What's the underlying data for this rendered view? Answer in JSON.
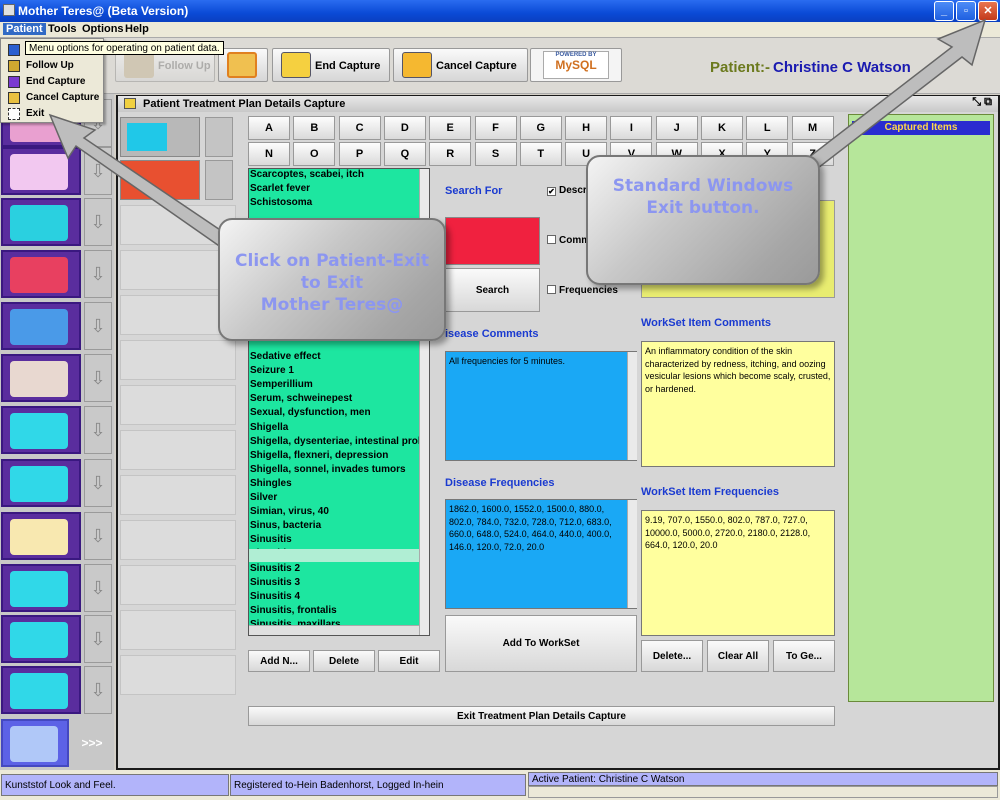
{
  "window": {
    "title": "Mother Teres@ (Beta Version)",
    "btn_minimize": "_",
    "btn_maximize": "▫",
    "btn_close": "✕"
  },
  "menubar": {
    "items": [
      "Patient",
      "Tools",
      "Options",
      "Help"
    ]
  },
  "patient_menu": {
    "tooltip": "Menu options for operating on patient data.",
    "items": [
      "Follow Up",
      "End Capture",
      "Cancel Capture",
      "Exit"
    ]
  },
  "toolbar": {
    "follow_up": "Follow Up",
    "end_capture": "End Capture",
    "cancel_capture": "Cancel Capture",
    "mysql_top": "POWERED BY",
    "mysql_bottom": "MySQL",
    "patient_label": "Patient:-",
    "patient_name": "Christine C Watson"
  },
  "left_panel": {
    "more_label": ">>>"
  },
  "inner_window": {
    "title": "Patient Treatment Plan Details Capture",
    "letters_row1": [
      "A",
      "B",
      "C",
      "D",
      "E",
      "F",
      "G",
      "H",
      "I",
      "J",
      "K",
      "L",
      "M"
    ],
    "letters_row2": [
      "N",
      "O",
      "P",
      "Q",
      "R",
      "S",
      "T",
      "U",
      "V",
      "W",
      "X",
      "Y",
      "Z"
    ],
    "disease_list_top": [
      "Scarcoptes, scabei, itch",
      "Scarlet fever",
      "Schistosoma"
    ],
    "disease_list_bottom": [
      "Sedative effect",
      "Seizure 1",
      "Semperillium",
      "Serum, schweinepest",
      "Sexual, dysfunction, men",
      "Shigella",
      "Shigella, dysenteriae, intestinal problems",
      "Shigella, flexneri, depression",
      "Shigella, sonnel, invades tumors",
      "Shingles",
      "Silver",
      "Simian, virus, 40",
      "Sinus, bacteria",
      "Sinusitis",
      "Sinusitis 1",
      "Sinusitis 2",
      "Sinusitis 3",
      "Sinusitis 4",
      "Sinusitis, frontalis",
      "Sinusitis, maxillars"
    ],
    "list_buttons": [
      "Add N...",
      "Delete",
      "Edit"
    ],
    "search_for": "Search For",
    "search_button": "Search",
    "checkboxes": [
      {
        "label": "Descri",
        "checked": true
      },
      {
        "label": "Comm",
        "checked": false
      },
      {
        "label": "Frequencies",
        "checked": false
      }
    ],
    "check_mark": "✔",
    "disease_comments_label": "isease Comments",
    "disease_comments": "All frequencies for 5 minutes.",
    "workset_comments_label": "WorkSet Item Comments",
    "workset_comments": "An inflammatory condition of the skin characterized by redness, itching, and oozing vesicular lesions which become scaly, crusted, or hardened.",
    "disease_freq_label": "Disease Frequencies",
    "disease_freq": "1862.0, 1600.0, 1552.0, 1500.0, 880.0, 802.0, 784.0, 732.0, 728.0, 712.0, 683.0, 660.0, 648.0, 524.0, 464.0, 440.0, 400.0, 146.0, 120.0, 72.0, 20.0",
    "workset_freq_label": "WorkSet Item Frequencies",
    "workset_freq": "9.19, 707.0, 1550.0, 802.0, 787.0, 727.0, 10000.0, 5000.0, 2720.0, 2180.0, 2128.0, 664.0, 120.0, 20.0",
    "add_to_workset": "Add To WorkSet",
    "ws_buttons": [
      "Delete...",
      "Clear All",
      "To Ge..."
    ],
    "exit_button": "Exit Treatment Plan Details Capture",
    "captured_items": "Captured Items"
  },
  "callouts": {
    "exit_hint": [
      "Click on Patient-Exit",
      "to Exit",
      "Mother Teres@"
    ],
    "windows_hint": [
      "Standard Windows",
      "Exit button."
    ]
  },
  "statusbar": {
    "laf": "Kunststof Look and Feel.",
    "registered": "Registered to-Hein Badenhorst, Logged In-hein",
    "active_patient": "Active Patient: Christine C Watson"
  },
  "colors": {
    "disease_list": "#1de6a0",
    "search_red": "#f0213f",
    "blue_area": "#1aa8f5",
    "yellow_area": "#ffff9e",
    "captured_green": "#b6e69a",
    "left_purple": "#5a2d9e",
    "status_lavender": "#b2b4fa"
  }
}
